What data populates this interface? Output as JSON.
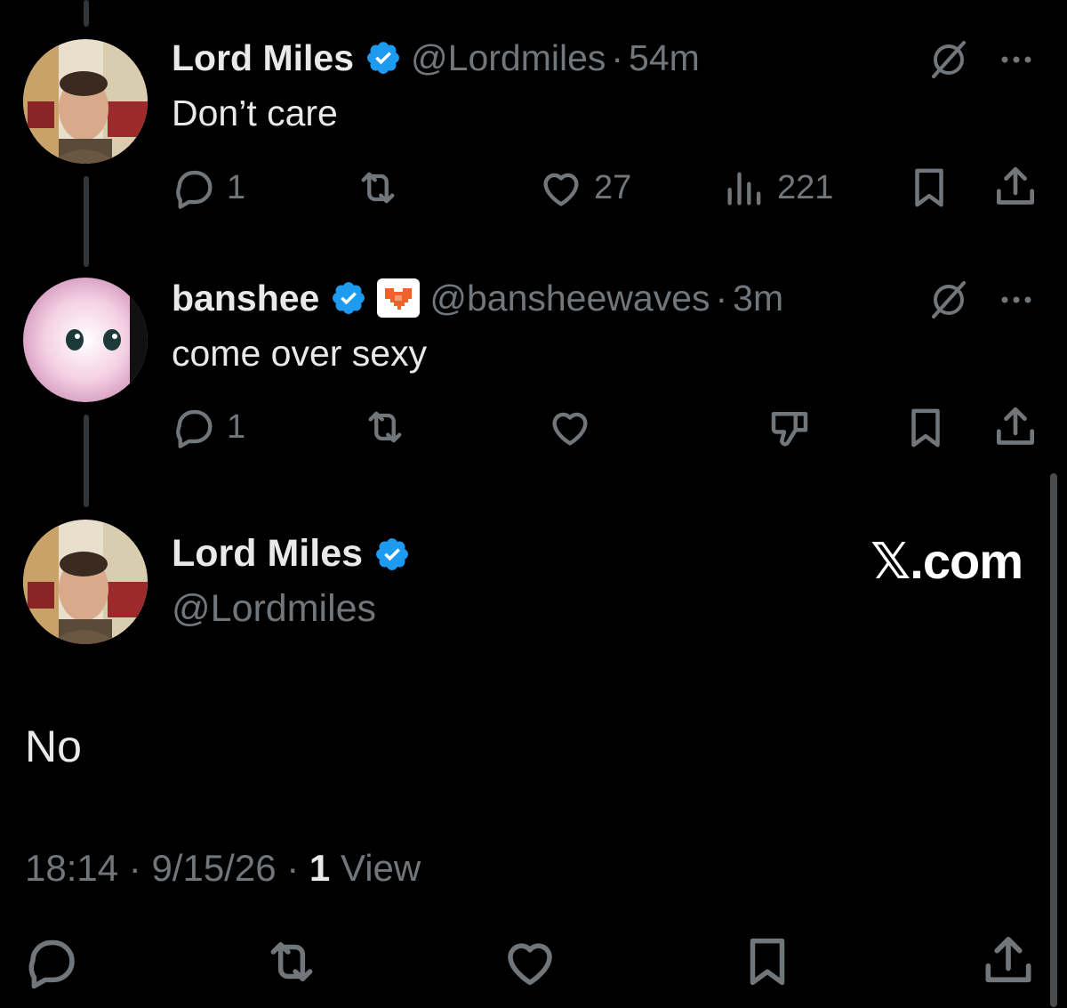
{
  "tweets": [
    {
      "display_name": "Lord Miles",
      "handle": "@Lordmiles",
      "time": "54m",
      "text": "Don’t care",
      "avatar_icon": "avatar-lord-miles",
      "actions": {
        "reply_count": "1",
        "like_count": "27",
        "view_count": "221"
      }
    },
    {
      "display_name": "banshee",
      "handle": "@bansheewaves",
      "time": "3m",
      "text": "come over sexy",
      "avatar_icon": "avatar-banshee",
      "affiliate_badge_icon": "pixel-heart-badge-icon",
      "actions": {
        "reply_count": "1"
      }
    }
  ],
  "main_tweet": {
    "display_name": "Lord Miles",
    "handle": "@Lordmiles",
    "watermark": "𝕏.com",
    "text": "No",
    "time": "18:14",
    "date": "9/15/26",
    "view_count": "1",
    "view_label": "View"
  },
  "colors": {
    "background": "#000000",
    "text": "#e7e9ea",
    "secondary": "#71767b",
    "verified": "#1d9bf0",
    "thread_line": "#333639"
  }
}
